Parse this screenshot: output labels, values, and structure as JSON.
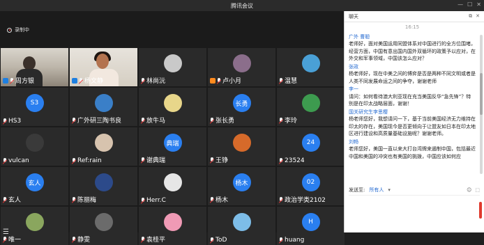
{
  "window": {
    "title": "腾讯会议",
    "controls": [
      "minimize-icon",
      "maximize-icon",
      "close-icon"
    ]
  },
  "recording": {
    "label": "录制中"
  },
  "participants": [
    {
      "name": "周方银",
      "type": "video1",
      "icon": "person"
    },
    {
      "name": "杨文静",
      "type": "video2",
      "icon": "person",
      "active": true
    },
    {
      "name": "林尚沅",
      "type": "avatar",
      "color": "#c9c9c9"
    },
    {
      "name": "卢小月",
      "type": "avatar",
      "color": "#8b6e8b",
      "icon": "person-orange"
    },
    {
      "name": "温慧",
      "type": "avatar",
      "color": "#4aa0d6"
    },
    {
      "name": "HS3",
      "type": "circle",
      "label": "S3"
    },
    {
      "name": "广外研三陶书良",
      "type": "avatar",
      "color": "#3a7fc8"
    },
    {
      "name": "放牛马",
      "type": "avatar",
      "color": "#e8d68a"
    },
    {
      "name": "张长勇",
      "type": "circle",
      "label": "长勇"
    },
    {
      "name": "李玲",
      "type": "avatar",
      "color": "#3d9b4f"
    },
    {
      "name": "vulcan",
      "type": "avatar",
      "color": "#3a3a3a"
    },
    {
      "name": "Ref:rain",
      "type": "avatar",
      "color": "#d7c3ae"
    },
    {
      "name": "谢典瑞",
      "type": "circle",
      "label": "典瑞"
    },
    {
      "name": "王铮",
      "type": "avatar",
      "color": "#d66a2a"
    },
    {
      "name": "23524",
      "type": "circle",
      "label": "24"
    },
    {
      "name": "玄人",
      "type": "circle",
      "label": "玄人"
    },
    {
      "name": "陈丽梅",
      "type": "avatar",
      "color": "#2c4a8a"
    },
    {
      "name": "Herr.C",
      "type": "avatar",
      "color": "#e6e6e6"
    },
    {
      "name": "杨木",
      "type": "circle",
      "label": "杨木"
    },
    {
      "name": "政治学类2102",
      "type": "circle",
      "label": "02"
    },
    {
      "name": "唯一",
      "type": "avatar",
      "color": "#8aa65e"
    },
    {
      "name": "静雯",
      "type": "avatar",
      "color": "#6b6b6b"
    },
    {
      "name": "袁桂平",
      "type": "avatar",
      "color": "#f09ab5"
    },
    {
      "name": "ToD",
      "type": "avatar",
      "color": "#7dbde8"
    },
    {
      "name": "huang",
      "type": "circle",
      "label": "H"
    }
  ],
  "chat": {
    "title": "聊天",
    "time": "16:15",
    "messages": [
      {
        "sender": "广外 曹聪",
        "text": "老师好，面对美国运用同盟体系对中国进行的全方位围堵，经营方面，中国有意出国内国外双循环的政策予以应对，在外交和军事领域，中国该怎么应对？"
      },
      {
        "sender": "张政",
        "text": "杨老师好，现在中美之间的博弈是否是两种不同文明或者是人类不同发展命运之间的争夺，谢谢老师"
      },
      {
        "sender": "李一",
        "text": "请问：如何看待澳大利亚现在充当美国反华“急先锋”？特别是在印太战略层面，谢谢！"
      },
      {
        "sender": "国关研究生李思樱",
        "text": "杨老师您好，我想请问一下，基于当前美国经济无力维持在印太的存在，美国现今是否更倾向于让盟友如日本在印太地区进行建设和高质量基础设施呢？谢谢老师。"
      },
      {
        "sender": "刘畅",
        "text": "老师您好，美国一直以来大打台湾牌来遏制中国，包括最近中国和美国的冲突也有美国的挑拨，中国应该如何应"
      }
    ],
    "send_label": "发送至:",
    "send_target": "所有人"
  }
}
